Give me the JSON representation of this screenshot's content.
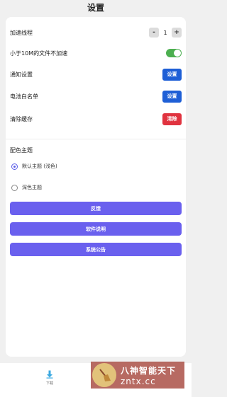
{
  "header": {
    "title": "设置"
  },
  "settings": {
    "threads": {
      "label": "加速线程",
      "minus": "-",
      "value": "1",
      "plus": "+"
    },
    "small_file": {
      "label": "小于10M的文件不加速",
      "enabled": true,
      "toggle_color": "#4caf50"
    },
    "notify": {
      "label": "通知设置",
      "button": "设置",
      "button_color": "#1e5fd6"
    },
    "battery": {
      "label": "电池白名单",
      "button": "设置",
      "button_color": "#1e5fd6"
    },
    "cache": {
      "label": "清除缓存",
      "button": "清除",
      "button_color": "#e0333f"
    }
  },
  "theme": {
    "title": "配色主题",
    "options": [
      {
        "label": "默认主题 (浅色)",
        "selected": true
      },
      {
        "label": "深色主题",
        "selected": false
      }
    ]
  },
  "actions": {
    "color": "#6a60ee",
    "feedback": "反馈",
    "manual": "软件说明",
    "notice": "系统公告"
  },
  "bottom_nav": {
    "download_label": "下载",
    "download_icon": "download-arrow-icon"
  },
  "watermark": {
    "line1": "八神智能天下",
    "line2": "zntx.cc",
    "logo": "broom-icon"
  }
}
